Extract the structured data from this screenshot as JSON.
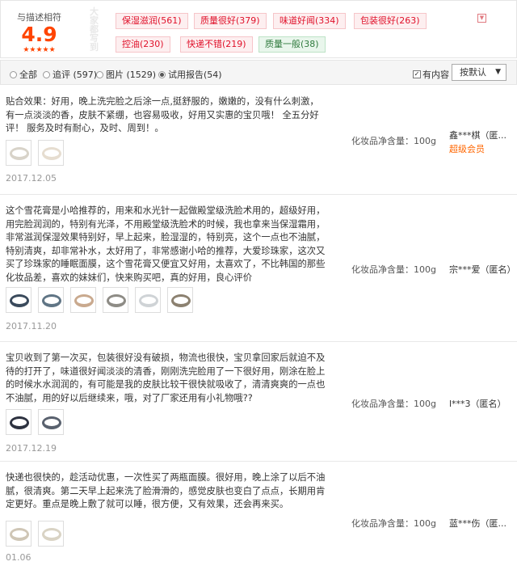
{
  "rating": {
    "label": "与描述相符",
    "score": "4.9",
    "stars": "★★★★★",
    "impression_title": "大家都写到"
  },
  "tags": {
    "positive": [
      "保湿滋润(561)",
      "质量很好(379)",
      "味道好闻(334)",
      "包装很好(263)",
      "控油(230)",
      "快递不错(219)"
    ],
    "negative": [
      "质量一般(38)"
    ],
    "toggle_icon": "chevron-down-icon"
  },
  "filter": {
    "options": [
      "全部",
      "追评 (597)",
      "图片 (1529)",
      "试用报告(54)"
    ],
    "selected_index": 3,
    "has_content_label": "有内容",
    "has_content_checked": true,
    "sort_label": "按默认"
  },
  "reviews": [
    {
      "text": "贴合效果：好用，晚上洗完脸之后涂一点,挺舒服的，嫩嫩的，没有什么刺激，有一点淡淡的香，皮肤不紧绷，也容易吸收，好用又实惠的宝贝哦！ 全五分好评！ 服务及时有耐心，及时、周到！。",
      "photos": 2,
      "date": "2017.12.05",
      "spec": "化妆品净含量：100g",
      "user": "鑫***棋（匿...",
      "badge": "超级会员"
    },
    {
      "text": "这个雪花膏是小哈推荐的，用来和水光针一起做殿堂级洗脸术用的，超级好用，用完脸润润的，特别有光泽，不用殿堂级洗脸术的时候，我也拿来当保湿霜用，非常滋润保湿效果特别好，早上起来，脸湿湿的，特别亮，这个一点也不油腻，特别清爽，却非常补水，太好用了，非常感谢小哈的推荐，大爱珍珠家，这次又买了珍珠家的睡眠面膜，这个雪花膏又便宜又好用，太喜欢了，不比韩国的那些化妆品差，喜欢的妹妹们，快来购买吧，真的好用，良心评价",
      "photos": 6,
      "date": "2017.11.20",
      "spec": "化妆品净含量：100g",
      "user": "宗***爱（匿名）",
      "badge": ""
    },
    {
      "text": "宝贝收到了第一次买，包装很好没有破损，物流也很快，宝贝拿回家后就迫不及待的打开了，味道很好闻淡淡的清香，刚刚洗完脸用了一下很好用，刚涂在脸上的时候水水润润的，有可能是我的皮肤比较干很快就吸收了，清清爽爽的一点也不油腻，用的好以后继续来，哦，对了厂家还用有小礼物哦??",
      "photos": 2,
      "date": "2017.12.19",
      "spec": "化妆品净含量：100g",
      "user": "l***3（匿名）",
      "badge": ""
    },
    {
      "text": "快递也很快的，趁活动优惠，一次性买了两瓶面膜。很好用，晚上涂了以后不油腻，很清爽。第二天早上起来洗了脸滑滑的，感觉皮肤也变白了点点，长期用肯定更好。重点是晚上敷了就可以睡，很方便，又有效果，还会再来买。",
      "photos": 2,
      "date": "01.06",
      "spec": "化妆品净含量：100g",
      "user": "蓝***伤（匿...",
      "badge": ""
    }
  ]
}
